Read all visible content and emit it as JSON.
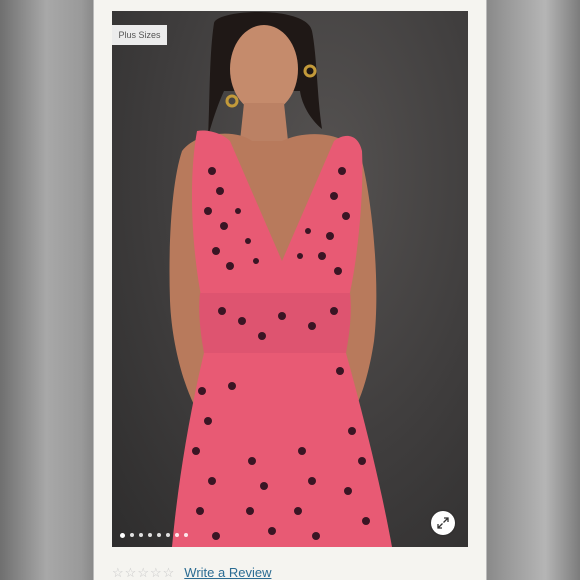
{
  "product": {
    "badge": "Plus Sizes",
    "rating_stars": [
      "☆",
      "☆",
      "☆",
      "☆",
      "☆"
    ],
    "write_review": "Write a Review"
  },
  "carousel": {
    "total_slides": 8,
    "active_index": 0
  },
  "colors": {
    "dress": "#e85a74",
    "dots_print": "#3a1524",
    "link": "#2b6c93"
  }
}
